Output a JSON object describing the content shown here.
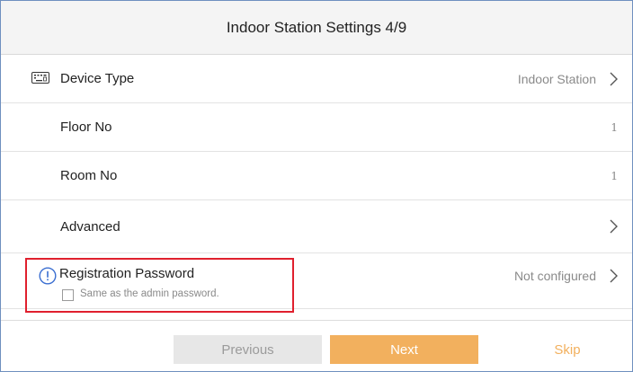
{
  "header": {
    "title": "Indoor Station Settings 4/9"
  },
  "rows": [
    {
      "label": "Device Type",
      "value": "Indoor Station",
      "icon": "keyboard-icon"
    },
    {
      "label": "Floor No",
      "value": "1"
    },
    {
      "label": "Room No",
      "value": "1"
    },
    {
      "label": "Advanced",
      "value": ""
    }
  ],
  "registration": {
    "label": "Registration Password",
    "value": "Not configured",
    "checkbox_label": "Same as the admin password.",
    "checkbox_checked": false,
    "icon": "info-icon",
    "highlight_color": "#e0202e"
  },
  "footer": {
    "previous_label": "Previous",
    "next_label": "Next",
    "skip_label": "Skip"
  },
  "colors": {
    "accent": "#f2b05e",
    "disabled_button": "#e7e7e7",
    "border": "#6f8fbf",
    "info_icon": "#3b6fd1"
  }
}
